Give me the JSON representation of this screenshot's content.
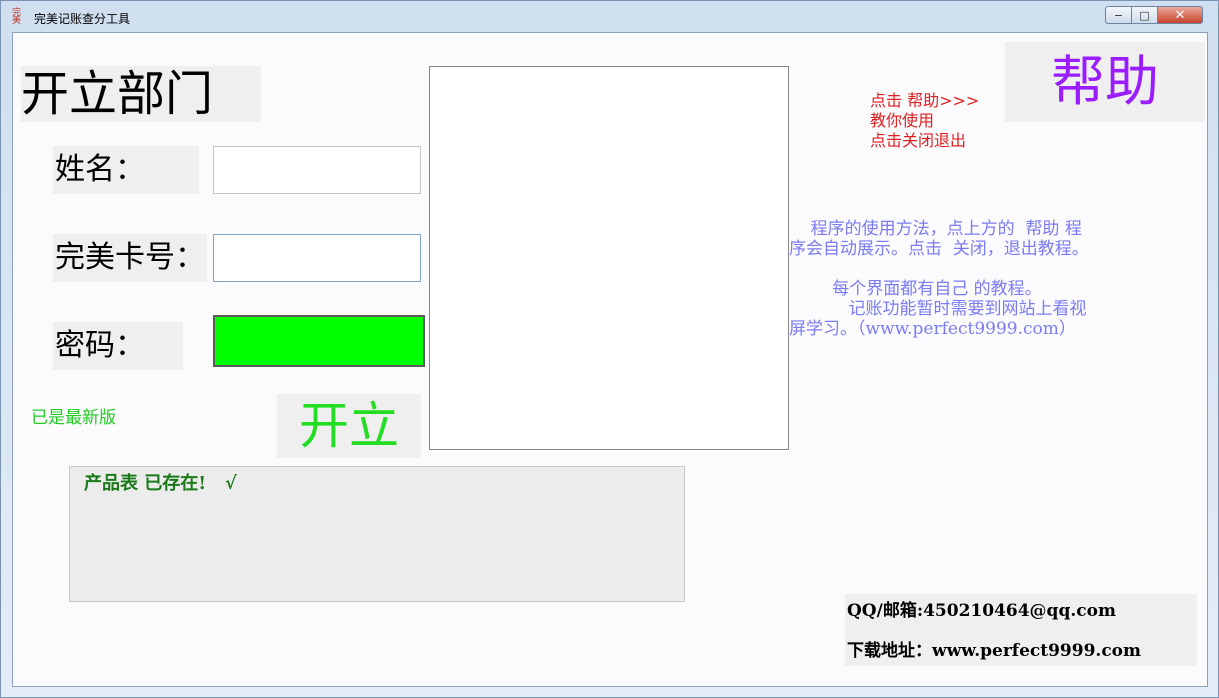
{
  "window": {
    "icon_label": "完美",
    "title": "完美记账查分工具",
    "minimize_glyph": "−",
    "maximize_glyph": "□",
    "close_glyph": "✕"
  },
  "form": {
    "heading": "开立部门",
    "name_label": "姓名：",
    "name_value": "",
    "card_label": "完美卡号：",
    "card_value": "",
    "password_label": "密码：",
    "password_value": "",
    "password_field_color": "#00ff00",
    "version_status": "已是最新版",
    "open_button": "开立"
  },
  "log": {
    "message": "产品表 已存在!   √"
  },
  "help": {
    "hint_line1": "点击  帮助>>>",
    "hint_line2": "教你使用",
    "hint_line3": "点击关闭退出",
    "button": "帮助"
  },
  "instructions": {
    "para1": "    程序的使用方法，点上方的  帮助 程\n序会自动展示。点击  关闭，退出教程。",
    "para2": "        每个界面都有自己 的教程。\n           记账功能暂时需要到网站上看视\n屏学习。（www.perfect9999.com）"
  },
  "contact": {
    "qq_email": "QQ/邮箱:450210464@qq.com",
    "download": "下载地址：www.perfect9999.com"
  }
}
